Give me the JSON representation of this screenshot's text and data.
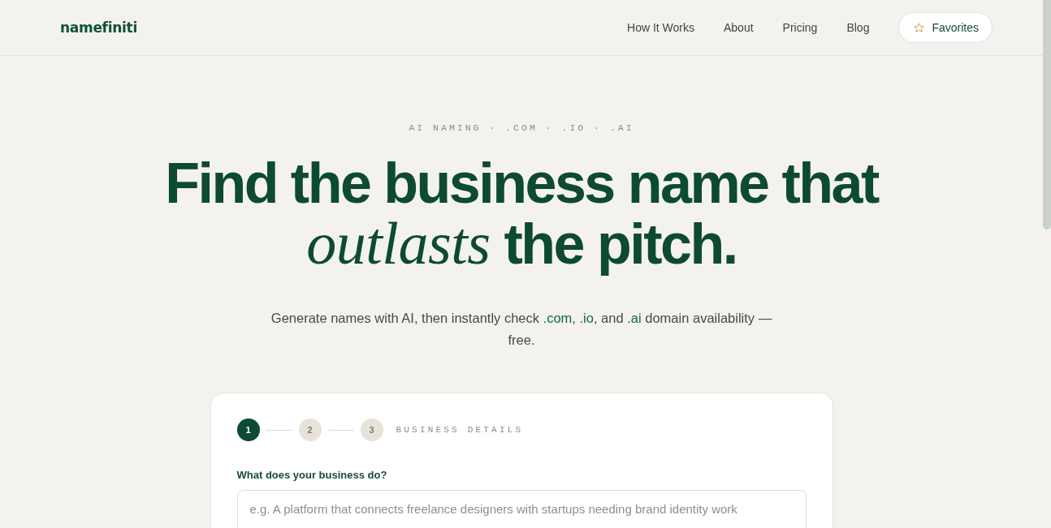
{
  "header": {
    "logo": "namefiniti",
    "nav": [
      {
        "label": "How It Works"
      },
      {
        "label": "About"
      },
      {
        "label": "Pricing"
      },
      {
        "label": "Blog"
      }
    ],
    "favorites_button": {
      "label": "Favorites"
    }
  },
  "hero": {
    "eyebrow": "AI NAMING · .COM · .IO · .AI",
    "headline": [
      "Find the business name that",
      "*outlasts* the pitch."
    ],
    "subtitle": [
      {
        "text": "Generate names with AI, then instantly check ",
        "highlight": false
      },
      {
        "text": ".com",
        "highlight": true
      },
      {
        "text": ", ",
        "highlight": false
      },
      {
        "text": ".io",
        "highlight": true
      },
      {
        "text": ", and ",
        "highlight": false
      },
      {
        "text": ".ai",
        "highlight": true
      },
      {
        "text": " domain availability — free.",
        "highlight": false
      }
    ]
  },
  "form_card": {
    "steps": [
      {
        "label": "1",
        "selected": true
      },
      {
        "label": "2",
        "selected": false
      },
      {
        "label": "3",
        "selected": false
      }
    ],
    "step_title": "BUSINESS DETAILS",
    "field": {
      "label": "What does your business do?",
      "placeholder": "e.g. A platform that connects freelance designers with startups needing brand identity work"
    }
  }
}
